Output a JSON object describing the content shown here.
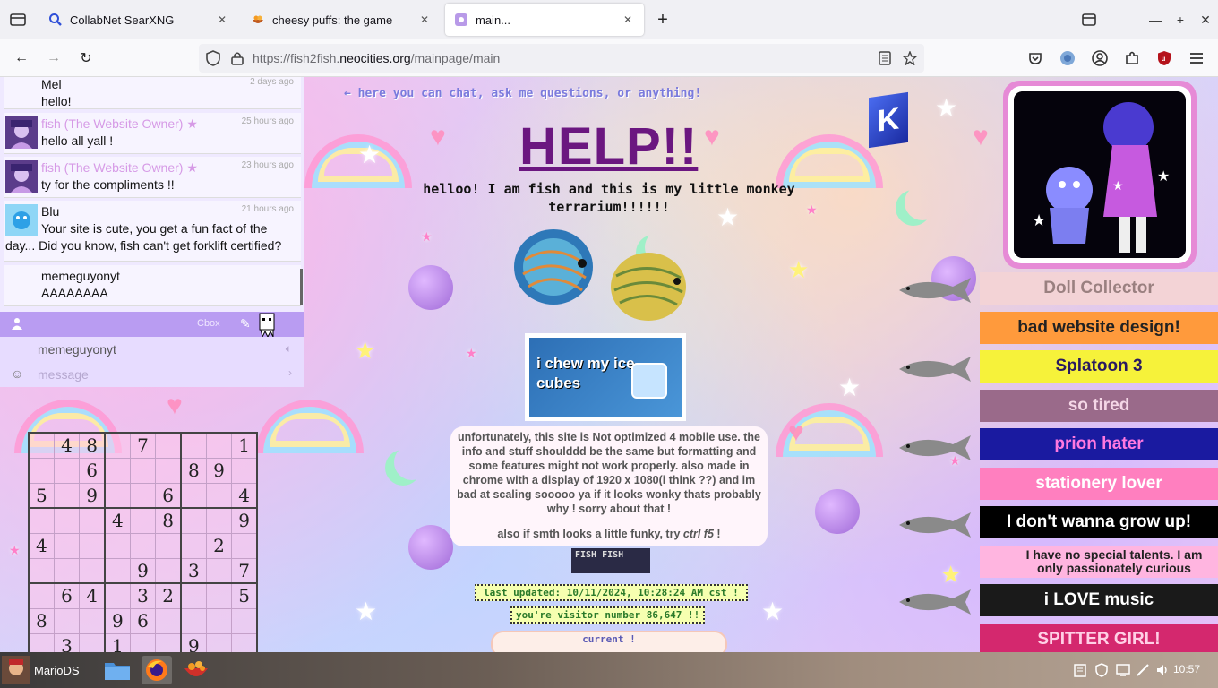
{
  "browser": {
    "tabs": [
      {
        "title": "CollabNet SearXNG",
        "icon": "search-icon",
        "active": false
      },
      {
        "title": "cheesy puffs: the game",
        "icon": "bowl-icon",
        "active": false
      },
      {
        "title": "main...",
        "icon": "page-icon",
        "active": true
      }
    ],
    "url_prefix": "https://fish2fish.",
    "url_domain": "neocities.org",
    "url_path": "/mainpage/main"
  },
  "chat": {
    "messages": [
      {
        "name": "Mel",
        "time": "2 days ago",
        "text": "hello!",
        "owner": false
      },
      {
        "name": "fish (The Website Owner)",
        "time": "25 hours ago",
        "text": "hello all yall !",
        "owner": true
      },
      {
        "name": "fish (The Website Owner)",
        "time": "23 hours ago",
        "text": "ty for the compliments !!",
        "owner": true
      },
      {
        "name": "Blu",
        "time": "21 hours ago",
        "text": "Your site is cute, you get a fun fact of the day... Did you know, fish can't get forklift certified?",
        "owner": false
      },
      {
        "name": "memeguyonyt",
        "time": "",
        "text": "AAAAAAAA",
        "owner": false
      }
    ],
    "bar_label": "Cbox",
    "username": "memeguyonyt",
    "message_placeholder": "message"
  },
  "sudoku": [
    [
      "",
      "4",
      "8",
      "",
      "7",
      "",
      "",
      "",
      "1"
    ],
    [
      "",
      "",
      "6",
      "",
      "",
      "",
      "8",
      "9",
      ""
    ],
    [
      "5",
      "",
      "9",
      "",
      "",
      "6",
      "",
      "",
      "4"
    ],
    [
      "",
      "",
      "",
      "4",
      "",
      "8",
      "",
      "",
      "9"
    ],
    [
      "4",
      "",
      "",
      "",
      "",
      "",
      "",
      "2",
      ""
    ],
    [
      "",
      "",
      "",
      "",
      "9",
      "",
      "3",
      "",
      "7"
    ],
    [
      "",
      "6",
      "4",
      "",
      "3",
      "2",
      "",
      "",
      "5"
    ],
    [
      "8",
      "",
      "",
      "9",
      "6",
      "",
      "",
      "",
      ""
    ],
    [
      "",
      "3",
      "",
      "1",
      "",
      "",
      "9",
      "",
      ""
    ]
  ],
  "page": {
    "chat_hint": "← here you can chat, ask me questions, or anything!",
    "title": "HELP!!",
    "intro": "helloo! I am fish and this is my little monkey terrarium!!!!!!",
    "ice_stamp": "i chew my ice cubes",
    "notice_1": "unfortunately, this site is Not optimized 4 mobile use. the info and stuff shoulddd be the same but formatting and some features might not work properly. also made in chrome with a display of 1920 x 1080(i think ??) and im bad at scaling sooooo ya if it looks wonky thats probably why ! sorry about that !",
    "notice_2_pre": "also if smth looks a little funky, try ",
    "notice_2_key": "ctrl f5",
    "notice_2_post": " !",
    "fishfish": "FISH FISH",
    "updated": "last updated: 10/11/2024, 10:28:24 AM cst !",
    "visitor": "you're visitor number 86,647 !!",
    "current": "current !"
  },
  "stamps": [
    {
      "text": "Doll Collector",
      "bg": "#f3d3d6",
      "fg": "#9a8080"
    },
    {
      "text": "bad website design!",
      "bg": "#ff9a3c",
      "fg": "#222"
    },
    {
      "text": "Splatoon 3",
      "bg": "#f6f23a",
      "fg": "#2a1a60"
    },
    {
      "text": "so tired",
      "bg": "#9a6a8a",
      "fg": "#f5d7e7"
    },
    {
      "text": "prion hater",
      "bg": "#1a1aa0",
      "fg": "#ff78e0"
    },
    {
      "text": "stationery lover",
      "bg": "#ff7fbf",
      "fg": "#fff"
    },
    {
      "text": "I don't wanna grow up!",
      "bg": "#000",
      "fg": "#fff"
    },
    {
      "text": "I have no special talents. I am only passionately curious",
      "bg": "#ffb5e0",
      "fg": "#222"
    },
    {
      "text": "i LOVE music",
      "bg": "#1a1a1a",
      "fg": "#fff"
    },
    {
      "text": "SPITTER GIRL!",
      "bg": "#d4286e",
      "fg": "#ffd0e6"
    }
  ],
  "taskbar": {
    "start_label": "MarioDS",
    "clock": "10:57"
  }
}
